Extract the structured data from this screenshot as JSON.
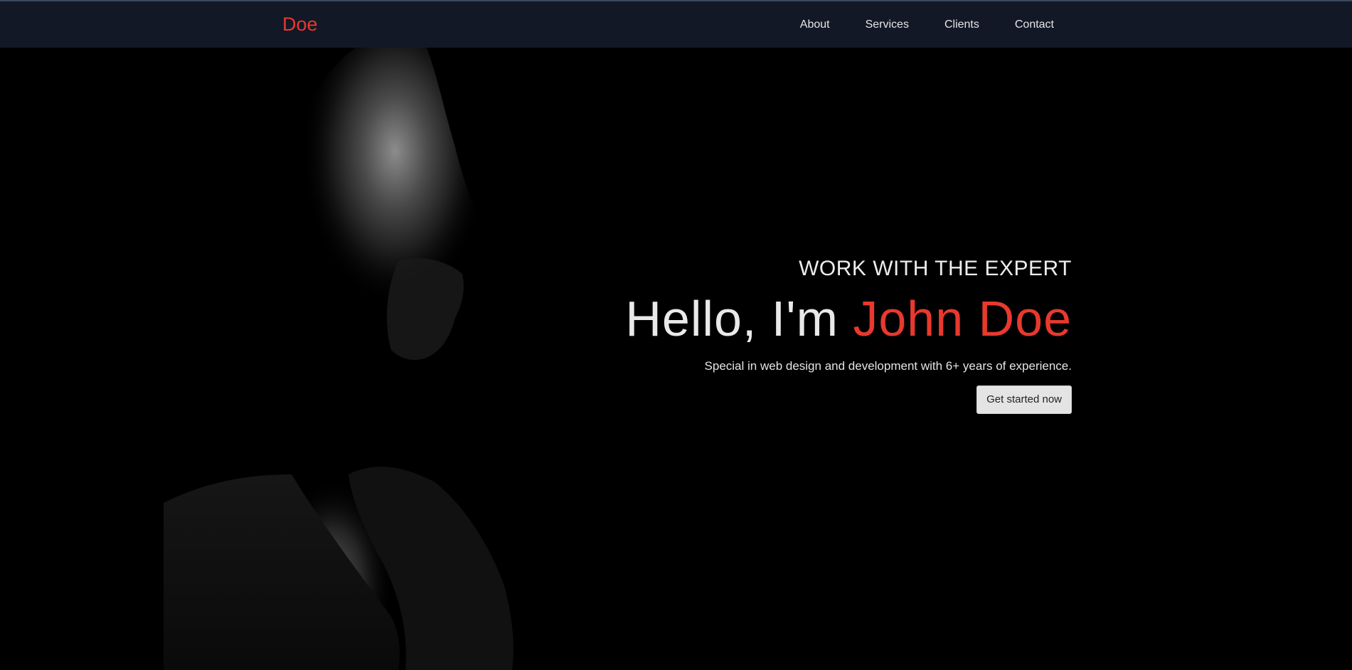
{
  "nav": {
    "brand": "Doe",
    "links": [
      {
        "label": "About"
      },
      {
        "label": "Services"
      },
      {
        "label": "Clients"
      },
      {
        "label": "Contact"
      }
    ]
  },
  "hero": {
    "kicker": "WORK WITH THE EXPERT",
    "title_prefix": "Hello, I'm ",
    "title_name": "John Doe",
    "subtitle": "Special in web design and development with 6+ years of experience.",
    "cta_label": "Get started now"
  },
  "colors": {
    "accent": "#e8392e",
    "navbar_bg": "#121826",
    "page_bg": "#000000",
    "text_light": "#e9e9e9",
    "button_bg": "#e4e4e4"
  }
}
